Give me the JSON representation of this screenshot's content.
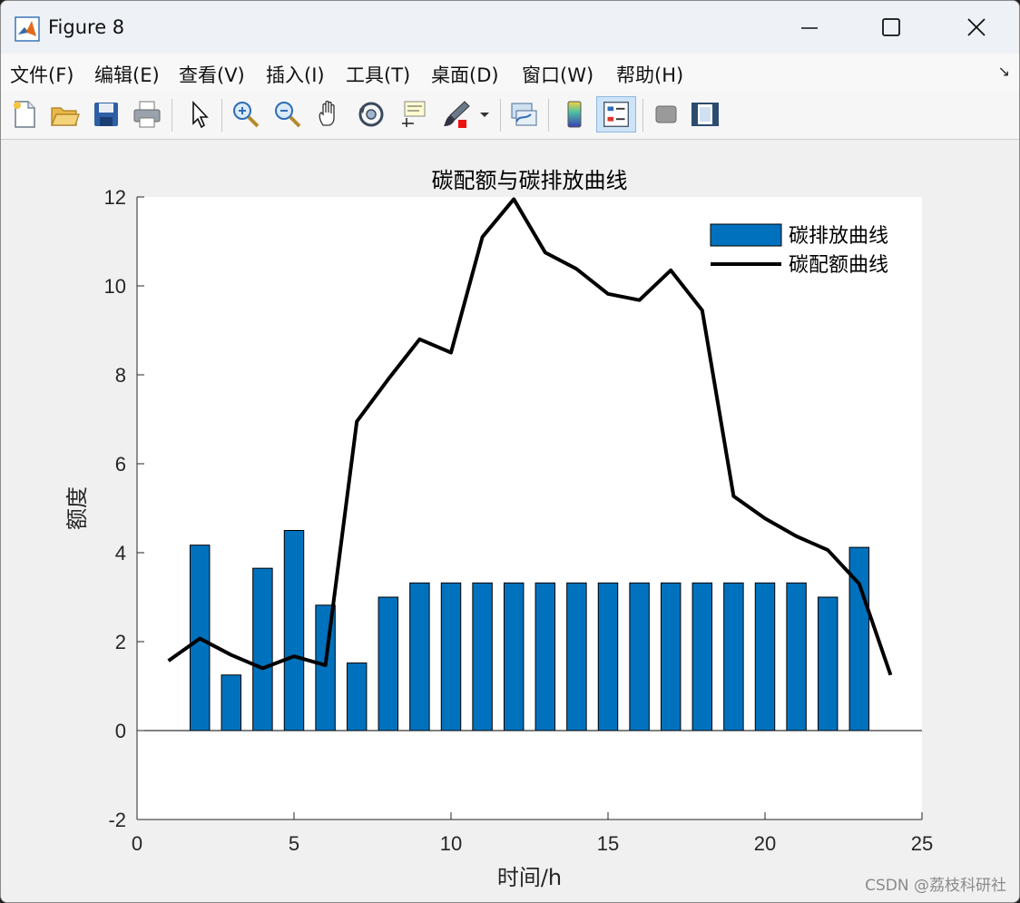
{
  "window": {
    "title": "Figure 8",
    "minimize_icon": "minimize-icon",
    "maximize_icon": "maximize-icon",
    "close_icon": "close-icon"
  },
  "menu": {
    "items": [
      {
        "label": "文件(F)"
      },
      {
        "label": "编辑(E)"
      },
      {
        "label": "查看(V)"
      },
      {
        "label": "插入(I)"
      },
      {
        "label": "工具(T)"
      },
      {
        "label": "桌面(D)"
      },
      {
        "label": "窗口(W)"
      },
      {
        "label": "帮助(H)"
      }
    ]
  },
  "toolbar": {
    "icons": [
      "new-figure-icon",
      "open-file-icon",
      "save-icon",
      "print-icon",
      "select-arrow-icon",
      "zoom-in-icon",
      "zoom-out-icon",
      "pan-hand-icon",
      "rotate-3d-icon",
      "data-cursor-icon",
      "brush-icon",
      "link-plot-icon",
      "colorbar-icon",
      "legend-icon",
      "hide-plot-tools-icon",
      "show-plot-tools-icon"
    ]
  },
  "watermark": "CSDN @荔枝科研社",
  "chart_data": {
    "type": "bar",
    "title": "碳配额与碳排放曲线",
    "xlabel": "时间/h",
    "ylabel": "额度",
    "xlim": [
      0,
      25
    ],
    "ylim": [
      -2,
      12
    ],
    "xticks": [
      0,
      5,
      10,
      15,
      20,
      25
    ],
    "yticks": [
      -2,
      0,
      2,
      4,
      6,
      8,
      10,
      12
    ],
    "grid": false,
    "legend_position": "top-right",
    "series": [
      {
        "name": "碳排放曲线",
        "type": "bar",
        "color": "#0072BD",
        "x": [
          1,
          2,
          3,
          4,
          5,
          6,
          7,
          8,
          9,
          10,
          11,
          12,
          13,
          14,
          15,
          16,
          17,
          18,
          19,
          20,
          21,
          22,
          23,
          24
        ],
        "values": [
          0,
          4.17,
          1.25,
          3.65,
          4.5,
          2.82,
          1.52,
          3.0,
          3.32,
          3.32,
          3.32,
          3.32,
          3.32,
          3.32,
          3.32,
          3.32,
          3.32,
          3.32,
          3.32,
          3.32,
          3.32,
          3.0,
          4.12,
          0
        ]
      },
      {
        "name": "碳配额曲线",
        "type": "line",
        "color": "#000000",
        "x": [
          1,
          2,
          3,
          4,
          5,
          6,
          7,
          8,
          9,
          10,
          11,
          12,
          13,
          14,
          15,
          16,
          17,
          18,
          19,
          20,
          21,
          22,
          23,
          24
        ],
        "values": [
          1.57,
          2.07,
          1.7,
          1.4,
          1.67,
          1.47,
          6.95,
          7.9,
          8.8,
          8.5,
          11.1,
          11.95,
          10.75,
          10.38,
          9.82,
          9.68,
          10.35,
          9.45,
          5.27,
          4.77,
          4.37,
          4.06,
          3.3,
          1.25
        ]
      }
    ]
  }
}
